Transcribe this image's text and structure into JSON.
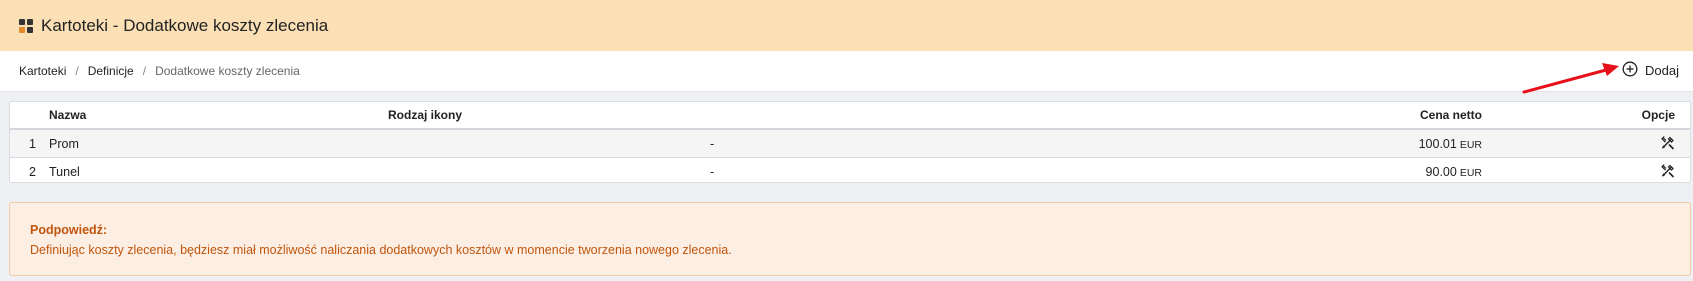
{
  "header": {
    "title": "Kartoteki - Dodatkowe koszty zlecenia",
    "logo_colors": [
      "#333333",
      "#333333",
      "#e8892a",
      "#333333"
    ]
  },
  "breadcrumb": {
    "items": [
      "Kartoteki",
      "Definicje",
      "Dodatkowe koszty zlecenia"
    ],
    "separator": "/"
  },
  "toolbar": {
    "add_label": "Dodaj",
    "add_icon": "plus-circle-icon",
    "arrow_color": "#e8101a"
  },
  "table": {
    "columns": [
      "Nazwa",
      "Rodzaj ikony",
      "Cena netto",
      "Opcje"
    ],
    "rows": [
      {
        "num": "1",
        "name": "Prom",
        "icon_type": "-",
        "price": "100.01",
        "currency": "EUR"
      },
      {
        "num": "2",
        "name": "Tunel",
        "icon_type": "-",
        "price": "90.00",
        "currency": "EUR"
      }
    ],
    "options_icon": "edit-tools-icon"
  },
  "hint": {
    "title": "Podpowiedź:",
    "text": "Definiując koszty zlecenia, będziesz miał możliwość naliczania dodatkowych kosztów w momencie tworzenia nowego zlecenia."
  }
}
